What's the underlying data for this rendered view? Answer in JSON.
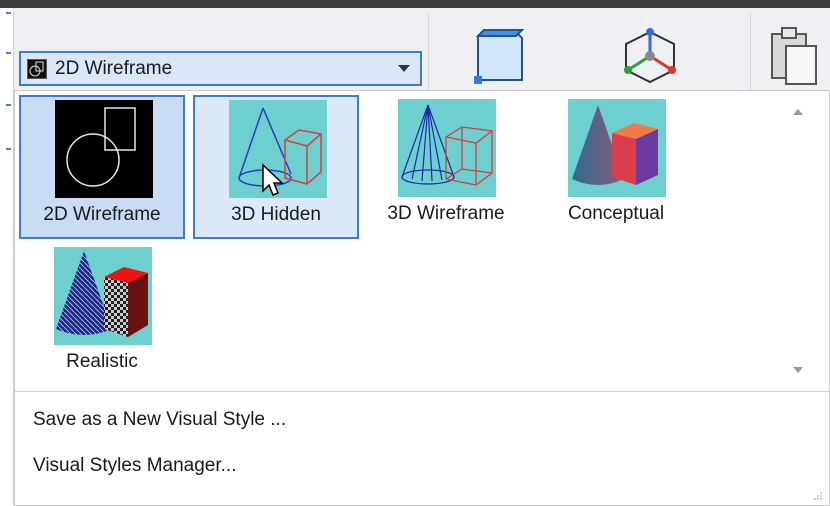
{
  "combo": {
    "value": "2D Wireframe"
  },
  "gallery": {
    "items": [
      {
        "label": "2D Wireframe",
        "state": "selected"
      },
      {
        "label": "3D Hidden",
        "state": "hover"
      },
      {
        "label": "3D Wireframe",
        "state": "normal"
      },
      {
        "label": "Conceptual",
        "state": "normal"
      },
      {
        "label": "Realistic",
        "state": "normal"
      }
    ]
  },
  "menu": {
    "save_label": "Save as a New Visual Style ...",
    "manager_label": "Visual Styles Manager..."
  },
  "colors": {
    "accent": "#3d7ad1",
    "thumb_bg": "#6ecfcf",
    "selected_bg": "#c9dcf4"
  }
}
